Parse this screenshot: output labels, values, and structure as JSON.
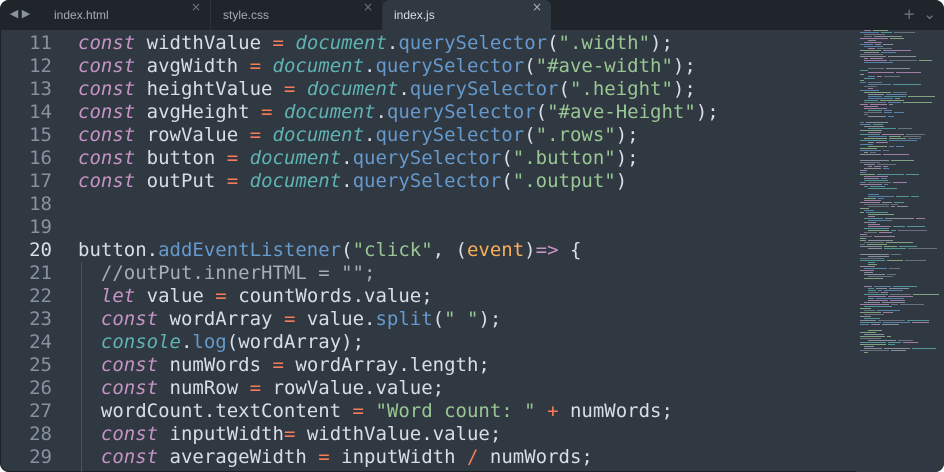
{
  "tabs": [
    {
      "label": "index.html",
      "active": false
    },
    {
      "label": "style.css",
      "active": false
    },
    {
      "label": "index.js",
      "active": true
    }
  ],
  "line_numbers": [
    "11",
    "12",
    "13",
    "14",
    "15",
    "16",
    "17",
    "18",
    "19",
    "20",
    "21",
    "22",
    "23",
    "24",
    "25",
    "26",
    "27",
    "28",
    "29"
  ],
  "current_line": "20",
  "lines": [
    [
      [
        "k",
        "const"
      ],
      [
        "t",
        " widthValue "
      ],
      [
        "o",
        "="
      ],
      [
        "t",
        " "
      ],
      [
        "b",
        "document"
      ],
      [
        "t",
        "."
      ],
      [
        "f",
        "querySelector"
      ],
      [
        "t",
        "("
      ],
      [
        "s",
        "\".width\""
      ],
      [
        "t",
        ");"
      ]
    ],
    [
      [
        "k",
        "const"
      ],
      [
        "t",
        " avgWidth "
      ],
      [
        "o",
        "="
      ],
      [
        "t",
        " "
      ],
      [
        "b",
        "document"
      ],
      [
        "t",
        "."
      ],
      [
        "f",
        "querySelector"
      ],
      [
        "t",
        "("
      ],
      [
        "s",
        "\"#ave-width\""
      ],
      [
        "t",
        ");"
      ]
    ],
    [
      [
        "k",
        "const"
      ],
      [
        "t",
        " heightValue "
      ],
      [
        "o",
        "="
      ],
      [
        "t",
        " "
      ],
      [
        "b",
        "document"
      ],
      [
        "t",
        "."
      ],
      [
        "f",
        "querySelector"
      ],
      [
        "t",
        "("
      ],
      [
        "s",
        "\".height\""
      ],
      [
        "t",
        ");"
      ]
    ],
    [
      [
        "k",
        "const"
      ],
      [
        "t",
        " avgHeight "
      ],
      [
        "o",
        "="
      ],
      [
        "t",
        " "
      ],
      [
        "b",
        "document"
      ],
      [
        "t",
        "."
      ],
      [
        "f",
        "querySelector"
      ],
      [
        "t",
        "("
      ],
      [
        "s",
        "\"#ave-Height\""
      ],
      [
        "t",
        ");"
      ]
    ],
    [
      [
        "k",
        "const"
      ],
      [
        "t",
        " rowValue "
      ],
      [
        "o",
        "="
      ],
      [
        "t",
        " "
      ],
      [
        "b",
        "document"
      ],
      [
        "t",
        "."
      ],
      [
        "f",
        "querySelector"
      ],
      [
        "t",
        "("
      ],
      [
        "s",
        "\".rows\""
      ],
      [
        "t",
        ");"
      ]
    ],
    [
      [
        "k",
        "const"
      ],
      [
        "t",
        " button "
      ],
      [
        "o",
        "="
      ],
      [
        "t",
        " "
      ],
      [
        "b",
        "document"
      ],
      [
        "t",
        "."
      ],
      [
        "f",
        "querySelector"
      ],
      [
        "t",
        "("
      ],
      [
        "s",
        "\".button\""
      ],
      [
        "t",
        ");"
      ]
    ],
    [
      [
        "k",
        "const"
      ],
      [
        "t",
        " outPut "
      ],
      [
        "o",
        "="
      ],
      [
        "t",
        " "
      ],
      [
        "b",
        "document"
      ],
      [
        "t",
        "."
      ],
      [
        "f",
        "querySelector"
      ],
      [
        "t",
        "("
      ],
      [
        "s",
        "\".output\""
      ],
      [
        "t",
        ")"
      ]
    ],
    [],
    [],
    [
      [
        "t",
        "button."
      ],
      [
        "f",
        "addEventListener"
      ],
      [
        "t",
        "("
      ],
      [
        "s",
        "\"click\""
      ],
      [
        "t",
        ", ("
      ],
      [
        "p",
        "event"
      ],
      [
        "t",
        ")"
      ],
      [
        "ar",
        "=>"
      ],
      [
        "t",
        " {"
      ]
    ],
    [
      [
        "t",
        "  "
      ],
      [
        "c",
        "//outPut.innerHTML = \"\";"
      ]
    ],
    [
      [
        "t",
        "  "
      ],
      [
        "k",
        "let"
      ],
      [
        "t",
        " value "
      ],
      [
        "o",
        "="
      ],
      [
        "t",
        " countWords.value;"
      ]
    ],
    [
      [
        "t",
        "  "
      ],
      [
        "k",
        "const"
      ],
      [
        "t",
        " wordArray "
      ],
      [
        "o",
        "="
      ],
      [
        "t",
        " value."
      ],
      [
        "f",
        "split"
      ],
      [
        "t",
        "("
      ],
      [
        "s",
        "\" \""
      ],
      [
        "t",
        ");"
      ]
    ],
    [
      [
        "t",
        "  "
      ],
      [
        "b",
        "console"
      ],
      [
        "t",
        "."
      ],
      [
        "f",
        "log"
      ],
      [
        "t",
        "(wordArray);"
      ]
    ],
    [
      [
        "t",
        "  "
      ],
      [
        "k",
        "const"
      ],
      [
        "t",
        " numWords "
      ],
      [
        "o",
        "="
      ],
      [
        "t",
        " wordArray.length;"
      ]
    ],
    [
      [
        "t",
        "  "
      ],
      [
        "k",
        "const"
      ],
      [
        "t",
        " numRow "
      ],
      [
        "o",
        "="
      ],
      [
        "t",
        " rowValue.value;"
      ]
    ],
    [
      [
        "t",
        "  wordCount.textContent "
      ],
      [
        "o",
        "="
      ],
      [
        "t",
        " "
      ],
      [
        "s",
        "\"Word count: \""
      ],
      [
        "t",
        " "
      ],
      [
        "o",
        "+"
      ],
      [
        "t",
        " numWords;"
      ]
    ],
    [
      [
        "t",
        "  "
      ],
      [
        "k",
        "const"
      ],
      [
        "t",
        " inputWidth"
      ],
      [
        "o",
        "="
      ],
      [
        "t",
        " widthValue.value;"
      ]
    ],
    [
      [
        "t",
        "  "
      ],
      [
        "k",
        "const"
      ],
      [
        "t",
        " averageWidth "
      ],
      [
        "o",
        "="
      ],
      [
        "t",
        " inputWidth "
      ],
      [
        "o",
        "/"
      ],
      [
        "t",
        " numWords;"
      ]
    ]
  ],
  "colors": {
    "editor_bg": "#303841",
    "tabbar_bg": "#1f252b",
    "keyword": "#c594c5",
    "builtin": "#5fb3b3",
    "function": "#6699cc",
    "string": "#99c794",
    "operator": "#f97b58",
    "parameter": "#f9ae58",
    "comment": "#a6acb9",
    "text": "#d8dee9"
  },
  "icons": {
    "nav_back": "◀",
    "nav_forward": "▶",
    "close": "×",
    "new_tab": "+",
    "tab_overflow": "⌄"
  }
}
